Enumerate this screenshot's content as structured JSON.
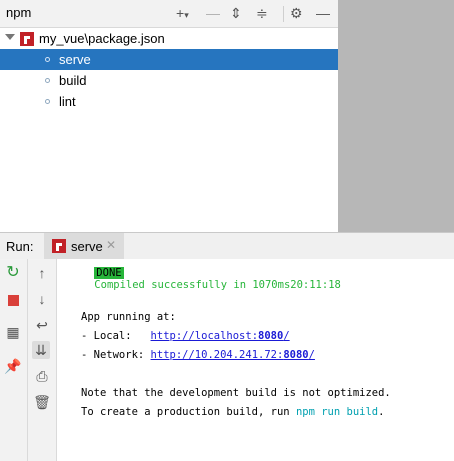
{
  "npm_panel": {
    "title": "npm",
    "toolbar_icons": [
      "add-icon",
      "remove-icon",
      "expand-icon",
      "collapse-icon",
      "gear-icon",
      "minimize-icon"
    ],
    "root": {
      "label": "my_vue\\package.json"
    },
    "scripts": [
      {
        "label": "serve",
        "selected": true
      },
      {
        "label": "build",
        "selected": false
      },
      {
        "label": "lint",
        "selected": false
      }
    ]
  },
  "run_panel": {
    "label": "Run:",
    "tab_label": "serve"
  },
  "console": {
    "done_badge": "DONE",
    "compiled_text": "Compiled successfully in 1070ms20:11:18",
    "app_running": "App running at:",
    "local_label": "- Local:   ",
    "local_url_prefix": "http://localhost:",
    "local_port": "8080",
    "local_suffix": "/",
    "network_label": "- Network: ",
    "network_url_prefix": "http://10.204.241.72:",
    "network_port": "8080",
    "network_suffix": "/",
    "note_line": "Note that the development build is not optimized.",
    "prod_prefix": "To create a production build, run ",
    "prod_cmd": "npm run build",
    "prod_suffix": "."
  },
  "colors": {
    "selection": "#2675bf",
    "done_green": "#27b53a",
    "link_blue": "#1a1ad6",
    "cmd_cyan": "#00a0b0"
  }
}
